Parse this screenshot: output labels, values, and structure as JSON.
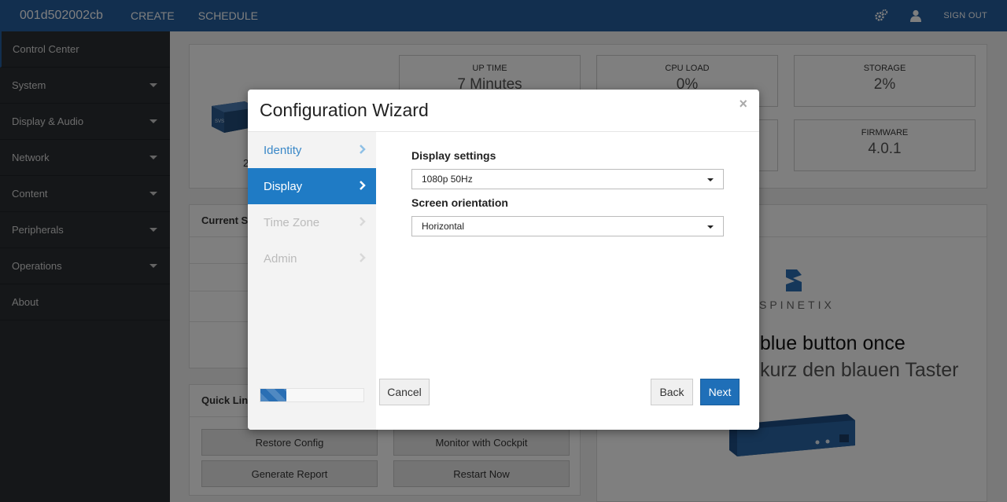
{
  "topbar": {
    "device_id": "001d502002cb",
    "nav": [
      "CREATE",
      "SCHEDULE"
    ],
    "signout_label": "SIGN OUT"
  },
  "sidebar": {
    "items": [
      {
        "label": "Control Center",
        "has_caret": false
      },
      {
        "label": "System",
        "has_caret": true
      },
      {
        "label": "Display & Audio",
        "has_caret": true
      },
      {
        "label": "Network",
        "has_caret": true
      },
      {
        "label": "Content",
        "has_caret": true
      },
      {
        "label": "Peripherals",
        "has_caret": true
      },
      {
        "label": "Operations",
        "has_caret": true
      },
      {
        "label": "About",
        "has_caret": false
      }
    ]
  },
  "dashboard": {
    "partial_label": "2",
    "stats": {
      "uptime": {
        "label": "UP TIME",
        "value": "7 Minutes"
      },
      "cpu": {
        "label": "CPU LOAD",
        "value": "0%"
      },
      "storage": {
        "label": "STORAGE",
        "value": "2%"
      },
      "firmware": {
        "label": "FIRMWARE",
        "value": "4.0.1"
      }
    },
    "current_status_title": "Current S",
    "quick_links_title": "Quick Lin",
    "quick_links": [
      "Restore Config",
      "Monitor with Cockpit",
      "Generate Report",
      "Restart Now"
    ],
    "logo_text": "SPINETIX",
    "instruction_en": "e blue button once",
    "instruction_de": "kurz den blauen Taster"
  },
  "wizard": {
    "title": "Configuration Wizard",
    "close_symbol": "×",
    "steps": [
      {
        "label": "Identity",
        "state": "done"
      },
      {
        "label": "Display",
        "state": "active"
      },
      {
        "label": "Time Zone",
        "state": "pending"
      },
      {
        "label": "Admin",
        "state": "pending"
      }
    ],
    "progress_fraction": 0.25,
    "display_settings_label": "Display settings",
    "display_settings_value": "1080p 50Hz",
    "orientation_label": "Screen orientation",
    "orientation_value": "Horizontal",
    "cancel_label": "Cancel",
    "back_label": "Back",
    "next_label": "Next"
  },
  "colors": {
    "topbar": "#255e9e",
    "sidebar": "#2b2f33",
    "accent": "#1f7bc5",
    "primary_button": "#1f6fb8"
  }
}
